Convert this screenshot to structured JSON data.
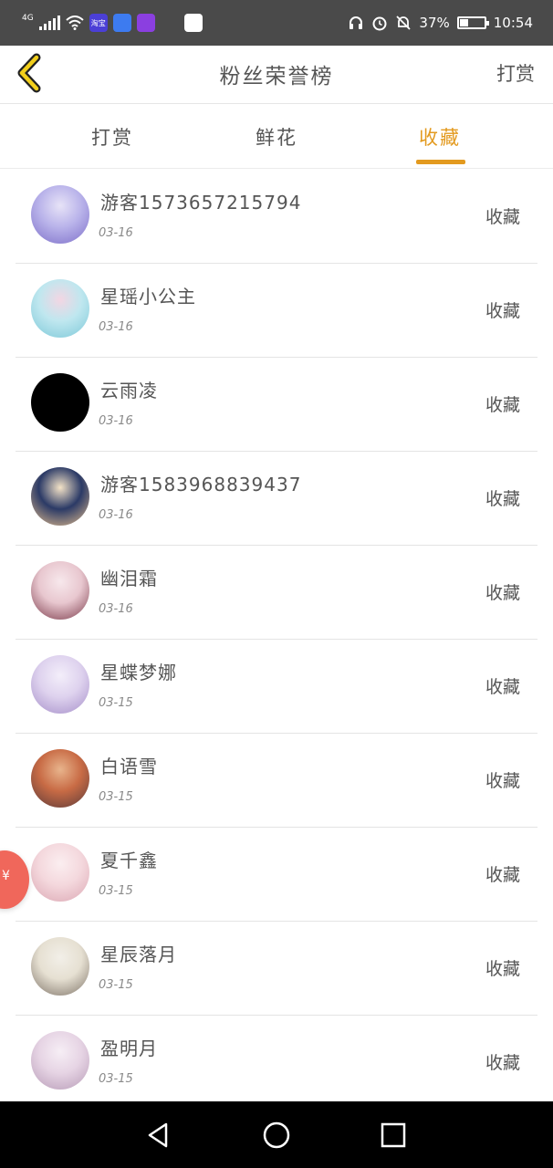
{
  "status_bar": {
    "network": "4G",
    "app_icons": [
      {
        "name": "taobao-app-icon",
        "label": "淘宝",
        "color": "#4b3fd6"
      },
      {
        "name": "baidu-app-icon",
        "label": "",
        "color": "#3d7bf0"
      },
      {
        "name": "video-app-icon",
        "label": "",
        "color": "#8b3fe0"
      },
      {
        "name": "wechat-app-icon",
        "label": "",
        "color": "#4a4a4a"
      },
      {
        "name": "paw-app-icon",
        "label": "",
        "color": "#ffffff"
      }
    ],
    "battery_percent": "37%",
    "battery_level": 0.37,
    "time": "10:54"
  },
  "header": {
    "title": "粉丝荣誉榜",
    "action": "打赏"
  },
  "tabs": [
    {
      "label": "打赏",
      "active": false
    },
    {
      "label": "鲜花",
      "active": false
    },
    {
      "label": "收藏",
      "active": true
    }
  ],
  "accent_color": "#e39a1f",
  "list": [
    {
      "name": "游客1573657215794",
      "date": "03-16",
      "action": "收藏",
      "avatar_colors": [
        "#b9b3ea",
        "#7d6fc9",
        "#e7e3f7"
      ]
    },
    {
      "name": "星瑶小公主",
      "date": "03-16",
      "action": "收藏",
      "avatar_colors": [
        "#bfe7ef",
        "#7cc8d8",
        "#f3d6e3"
      ]
    },
    {
      "name": "云雨凌",
      "date": "03-16",
      "action": "收藏",
      "avatar_colors": [
        "#000000",
        "#000000",
        "#000000"
      ]
    },
    {
      "name": "游客1583968839437",
      "date": "03-16",
      "action": "收藏",
      "avatar_colors": [
        "#2b3a66",
        "#e7c08e",
        "#f4e3c7"
      ]
    },
    {
      "name": "幽泪霜",
      "date": "03-16",
      "action": "收藏",
      "avatar_colors": [
        "#e8c7cf",
        "#7b3a4a",
        "#f7e8ec"
      ]
    },
    {
      "name": "星蝶梦娜",
      "date": "03-15",
      "action": "收藏",
      "avatar_colors": [
        "#ded2ee",
        "#a58ec9",
        "#f3eefa"
      ]
    },
    {
      "name": "白语雪",
      "date": "03-15",
      "action": "收藏",
      "avatar_colors": [
        "#c86b45",
        "#5a3a3a",
        "#e8b48c"
      ]
    },
    {
      "name": "夏千鑫",
      "date": "03-15",
      "action": "收藏",
      "avatar_colors": [
        "#f4d8dd",
        "#dba7b3",
        "#fbeef0"
      ]
    },
    {
      "name": "星辰落月",
      "date": "03-15",
      "action": "收藏",
      "avatar_colors": [
        "#e6e0d2",
        "#7d7267",
        "#f2efe8"
      ]
    },
    {
      "name": "盈明月",
      "date": "03-15",
      "action": "收藏",
      "avatar_colors": [
        "#e6d4e4",
        "#b79bb7",
        "#f6eef5"
      ]
    }
  ],
  "float_button": {
    "symbol": "¥",
    "color": "#f0675b"
  }
}
